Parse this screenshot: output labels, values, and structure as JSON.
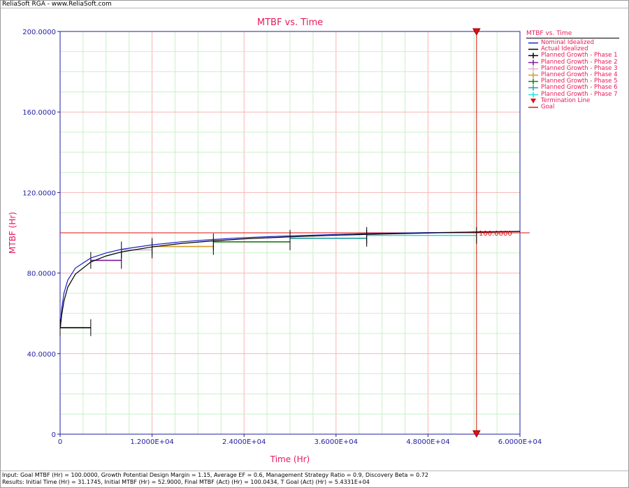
{
  "app": {
    "header": "ReliaSoft RGA - www.ReliaSoft.com"
  },
  "colors": {
    "accent": "#e8195a",
    "axis": "#1f1fa0",
    "grid_minor": "#c8f0c8",
    "grid_major": "#f8b4b4"
  },
  "chart_data": {
    "type": "line",
    "title": "MTBF vs. Time",
    "xlabel": "Time (Hr)",
    "ylabel": "MTBF (Hr)",
    "xlim": [
      0,
      60000
    ],
    "ylim": [
      0,
      200
    ],
    "x_ticks": [
      0,
      12000,
      24000,
      36000,
      48000,
      60000
    ],
    "x_tick_labels": [
      "0",
      "1.2000E+04",
      "2.4000E+04",
      "3.6000E+04",
      "4.8000E+04",
      "6.0000E+04"
    ],
    "y_ticks": [
      0,
      40,
      80,
      120,
      160,
      200
    ],
    "y_tick_labels": [
      "0",
      "40.0000",
      "80.0000",
      "120.0000",
      "160.0000",
      "200.0000"
    ],
    "grid": true,
    "legend_position": "right",
    "legend_title": "MTBF vs. Time",
    "series": [
      {
        "name": "Nominal Idealized",
        "color": "#1f1fc8",
        "x": [
          31,
          200,
          500,
          1000,
          2000,
          4000,
          6000,
          8000,
          12000,
          16000,
          20000,
          24000,
          30000,
          36000,
          40000,
          48000,
          54331,
          60000
        ],
        "y": [
          52.9,
          62,
          70,
          76.5,
          82.5,
          87.5,
          90,
          91.8,
          94,
          95.6,
          96.7,
          97.6,
          98.5,
          99.2,
          99.6,
          100.1,
          100.4,
          100.7
        ]
      },
      {
        "name": "Actual Idealized",
        "color": "#000000",
        "x": [
          31,
          200,
          500,
          1000,
          2000,
          4000,
          6000,
          8000,
          12000,
          16000,
          20000,
          24000,
          30000,
          36000,
          40000,
          48000,
          54331,
          60000
        ],
        "y": [
          52.9,
          59,
          66,
          73,
          79.5,
          85.5,
          88.5,
          90.5,
          93,
          94.8,
          96,
          97,
          98,
          98.8,
          99.2,
          99.9,
          100.4,
          100.7
        ]
      },
      {
        "name": "Planned Growth - Phase 1",
        "color": "#000000",
        "x": [
          0,
          4000
        ],
        "y": [
          52.9,
          52.9
        ]
      },
      {
        "name": "Planned Growth - Phase 2",
        "color": "#7a1a9a",
        "x": [
          4000,
          8000
        ],
        "y": [
          86.3,
          86.3
        ]
      },
      {
        "name": "Planned Growth - Phase 3",
        "color": "#d8b0c8",
        "x": [
          8000,
          12000
        ],
        "y": [
          91.5,
          91.5
        ]
      },
      {
        "name": "Planned Growth - Phase 4",
        "color": "#d49a2a",
        "x": [
          12000,
          20000
        ],
        "y": [
          93.2,
          93.2
        ]
      },
      {
        "name": "Planned Growth - Phase 5",
        "color": "#1a7a1a",
        "x": [
          20000,
          30000
        ],
        "y": [
          95.5,
          95.5
        ]
      },
      {
        "name": "Planned Growth - Phase 6",
        "color": "#20a0a0",
        "x": [
          30000,
          40000
        ],
        "y": [
          97.3,
          97.3
        ]
      },
      {
        "name": "Planned Growth - Phase 7",
        "color": "#20e0e0",
        "x": [
          40000,
          54331
        ],
        "y": [
          98.7,
          98.7
        ]
      }
    ],
    "phase_boundaries": [
      4000,
      8000,
      12000,
      20000,
      30000,
      40000
    ],
    "termination_line": {
      "name": "Termination Line",
      "x": 54331,
      "color": "#e01010"
    },
    "goal_line": {
      "name": "Goal",
      "y": 100,
      "label": "100.0000",
      "color": "#e01010"
    },
    "legend": [
      {
        "name": "Nominal Idealized",
        "color": "#1f1fc8",
        "marker": "line"
      },
      {
        "name": "Actual Idealized",
        "color": "#000000",
        "marker": "line"
      },
      {
        "name": "Planned Growth - Phase 1",
        "color": "#000000",
        "marker": "cross"
      },
      {
        "name": "Planned Growth - Phase 2",
        "color": "#7a1a9a",
        "marker": "cross"
      },
      {
        "name": "Planned Growth - Phase 3",
        "color": "#d8b0c8",
        "marker": "cross"
      },
      {
        "name": "Planned Growth - Phase 4",
        "color": "#d49a2a",
        "marker": "cross"
      },
      {
        "name": "Planned Growth - Phase 5",
        "color": "#1a7a1a",
        "marker": "cross"
      },
      {
        "name": "Planned Growth - Phase 6",
        "color": "#20a0a0",
        "marker": "cross"
      },
      {
        "name": "Planned Growth - Phase 7",
        "color": "#20e0e0",
        "marker": "cross"
      },
      {
        "name": "Termination Line",
        "color": "#e01010",
        "marker": "triangle"
      },
      {
        "name": "Goal",
        "color": "#e01010",
        "marker": "line"
      }
    ]
  },
  "footer": {
    "input": "Input: Goal MTBF (Hr) = 100.0000, Growth Potential Design Margin = 1.15, Average EF = 0.6, Management Strategy Ratio = 0.9, Discovery Beta = 0.72",
    "results": "Results: Initial Time (Hr) = 31.1745, Initial MTBF (Hr) = 52.9000, Final MTBF (Act) (Hr) = 100.0434, T Goal (Act) (Hr) = 5.4331E+04"
  }
}
